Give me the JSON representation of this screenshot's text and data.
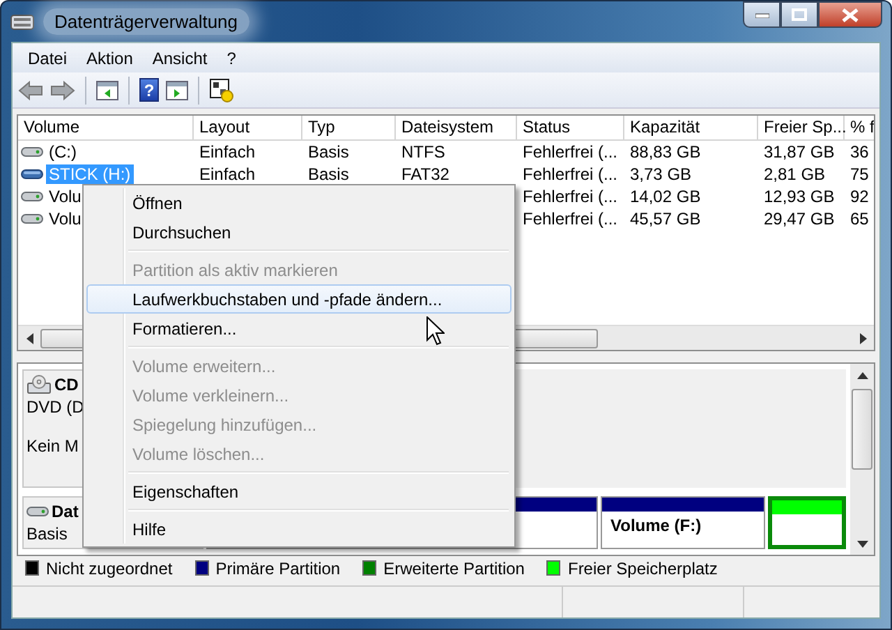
{
  "window": {
    "title": "Datenträgerverwaltung"
  },
  "menu_bar": [
    "Datei",
    "Aktion",
    "Ansicht",
    "?"
  ],
  "toolbar": {
    "help_glyph": "?"
  },
  "table": {
    "columns": [
      "Volume",
      "Layout",
      "Typ",
      "Dateisystem",
      "Status",
      "Kapazität",
      "Freier Sp...",
      "% f"
    ],
    "rows": [
      {
        "kind": "disk",
        "selected": false,
        "cells": [
          "(C:)",
          "Einfach",
          "Basis",
          "NTFS",
          "Fehlerfrei (...",
          "88,83 GB",
          "31,87 GB",
          "36"
        ]
      },
      {
        "kind": "stick",
        "selected": true,
        "cells": [
          "STICK (H:)",
          "Einfach",
          "Basis",
          "FAT32",
          "Fehlerfrei (...",
          "3,73 GB",
          "2,81 GB",
          "75"
        ]
      },
      {
        "kind": "disk",
        "selected": false,
        "cells": [
          "Volu",
          null,
          null,
          null,
          "Fehlerfrei (...",
          "14,02 GB",
          "12,93 GB",
          "92"
        ]
      },
      {
        "kind": "disk",
        "selected": false,
        "cells": [
          "Volu",
          null,
          null,
          null,
          "Fehlerfrei (...",
          "45,57 GB",
          "29,47 GB",
          "65"
        ]
      }
    ]
  },
  "disks": [
    {
      "kind": "cd",
      "name": "CD",
      "lines": [
        "DVD (D",
        "Kein M"
      ]
    },
    {
      "kind": "disk",
      "name": "Dat",
      "lines": [
        "Basis"
      ],
      "partitions": [
        {
          "color": "#000080",
          "selected": false
        },
        {
          "color": "#000080",
          "label": "Volume  (F:)",
          "selected": false
        },
        {
          "color": "#00ff00",
          "selected": true
        }
      ]
    }
  ],
  "legend": [
    {
      "label": "Nicht zugeordnet",
      "color": "#000000"
    },
    {
      "label": "Primäre Partition",
      "color": "#000080"
    },
    {
      "label": "Erweiterte Partition",
      "color": "#008000"
    },
    {
      "label": "Freier Speicherplatz",
      "color": "#00ff00"
    }
  ],
  "context_menu": [
    {
      "kind": "item",
      "label": "Öffnen",
      "disabled": false,
      "selected": false
    },
    {
      "kind": "item",
      "label": "Durchsuchen",
      "disabled": false,
      "selected": false
    },
    {
      "kind": "separator"
    },
    {
      "kind": "item",
      "label": "Partition als aktiv markieren",
      "disabled": true,
      "selected": false
    },
    {
      "kind": "item",
      "label": "Laufwerkbuchstaben und -pfade ändern...",
      "disabled": false,
      "selected": true
    },
    {
      "kind": "item",
      "label": "Formatieren...",
      "disabled": false,
      "selected": false
    },
    {
      "kind": "separator"
    },
    {
      "kind": "item",
      "label": "Volume erweitern...",
      "disabled": true,
      "selected": false
    },
    {
      "kind": "item",
      "label": "Volume verkleinern...",
      "disabled": true,
      "selected": false
    },
    {
      "kind": "item",
      "label": "Spiegelung hinzufügen...",
      "disabled": true,
      "selected": false
    },
    {
      "kind": "item",
      "label": "Volume löschen...",
      "disabled": true,
      "selected": false
    },
    {
      "kind": "separator"
    },
    {
      "kind": "item",
      "label": "Eigenschaften",
      "disabled": false,
      "selected": false
    },
    {
      "kind": "separator"
    },
    {
      "kind": "item",
      "label": "Hilfe",
      "disabled": false,
      "selected": false
    }
  ]
}
